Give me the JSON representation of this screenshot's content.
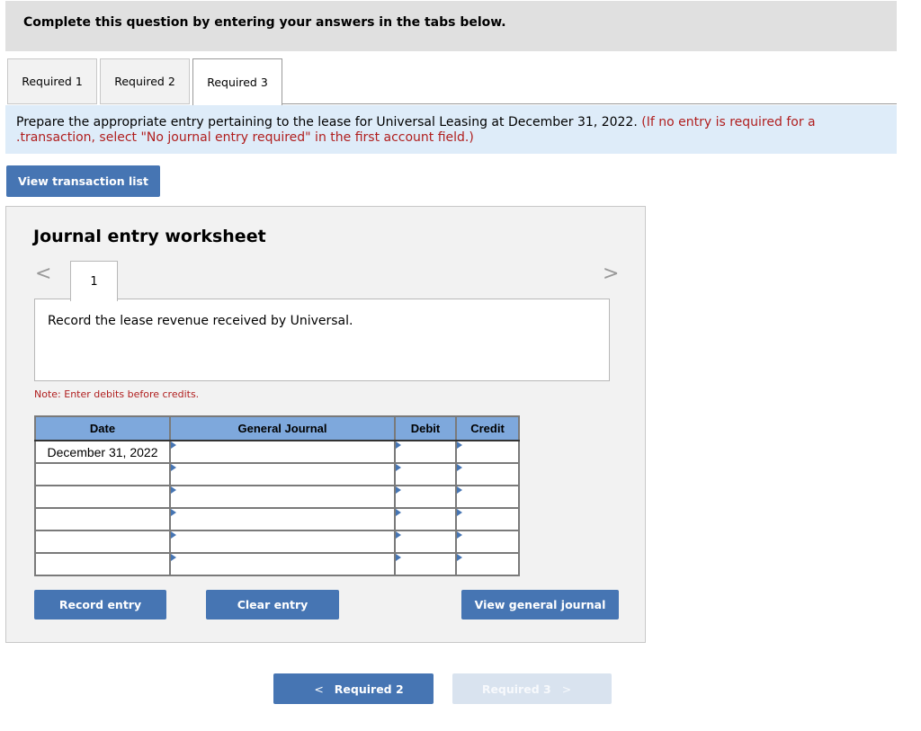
{
  "banner": {
    "text": "Complete this question by entering your answers in the tabs below."
  },
  "tabs": [
    {
      "label": "Required 1",
      "active": false
    },
    {
      "label": "Required 2",
      "active": false
    },
    {
      "label": "Required 3",
      "active": true
    }
  ],
  "prompt": {
    "text": "Prepare the appropriate entry pertaining to the lease for Universal Leasing at December 31, 2022.",
    "hint": "(If no entry is required for a .transaction, select \"No journal entry required\" in the first account field.)"
  },
  "view_transaction_list": "View transaction list",
  "worksheet": {
    "title": "Journal entry worksheet",
    "prev_icon": "chevron-left-icon",
    "next_icon": "chevron-right-icon",
    "prev_glyph": "<",
    "next_glyph": ">",
    "entry_tab": "1",
    "description": "Record the lease revenue received by Universal.",
    "note": "Note: Enter debits before credits.",
    "table": {
      "headers": [
        "Date",
        "General Journal",
        "Debit",
        "Credit"
      ],
      "rows": [
        {
          "date": "December 31, 2022",
          "account": "",
          "debit": "",
          "credit": ""
        },
        {
          "date": "",
          "account": "",
          "debit": "",
          "credit": ""
        },
        {
          "date": "",
          "account": "",
          "debit": "",
          "credit": ""
        },
        {
          "date": "",
          "account": "",
          "debit": "",
          "credit": ""
        },
        {
          "date": "",
          "account": "",
          "debit": "",
          "credit": ""
        },
        {
          "date": "",
          "account": "",
          "debit": "",
          "credit": ""
        }
      ]
    },
    "buttons": {
      "record": "Record entry",
      "clear": "Clear entry",
      "view_journal": "View general journal"
    }
  },
  "bottom_nav": {
    "prev": {
      "glyph": "<",
      "label": "Required 2",
      "enabled": true
    },
    "next": {
      "label": "Required 3",
      "glyph": ">",
      "enabled": false
    }
  },
  "colors": {
    "button_blue": "#4675b3",
    "table_header": "#7ea8dc",
    "prompt_bg": "#deecf9",
    "hint_red": "#b01e1e",
    "disabled_button": "#d9e3ef"
  }
}
